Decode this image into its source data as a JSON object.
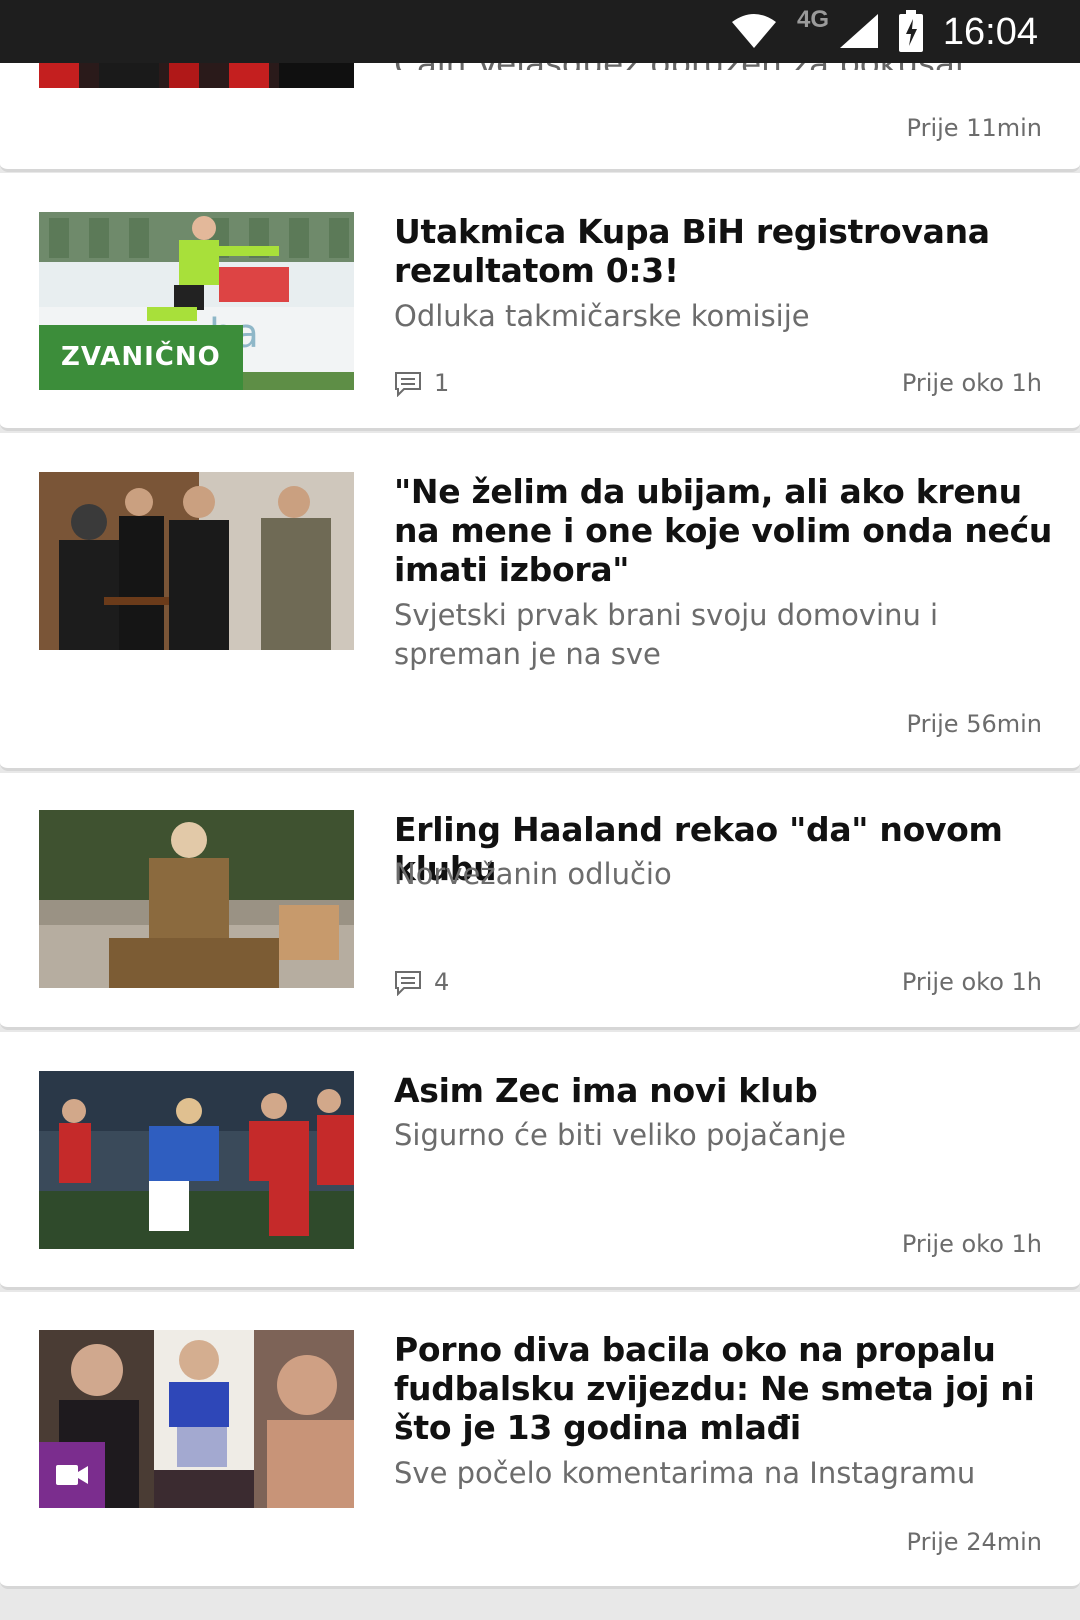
{
  "status_bar": {
    "time": "16:04",
    "network": "4G"
  },
  "articles": [
    {
      "title": "Čain Velasquez optužen za pokušaj ubistva",
      "subtitle": "",
      "time": "Prije 11min",
      "comments": ""
    },
    {
      "title": "Utakmica Kupa BiH registrovana rezultatom 0:3!",
      "subtitle": "Odluka takmičarske komisije",
      "time": "Prije oko 1h",
      "comments": "1",
      "badge": "ZVANIČNO"
    },
    {
      "title": "\"Ne želim da ubijam, ali ako krenu na mene i one koje volim onda neću imati izbora\"",
      "subtitle": "Svjetski prvak brani svoju domovinu i spreman je na sve",
      "time": "Prije 56min",
      "comments": ""
    },
    {
      "title": "Erling Haaland rekao \"da\" novom klubu",
      "subtitle": "Norvežanin odlučio",
      "time": "Prije oko 1h",
      "comments": "4"
    },
    {
      "title": "Asim Zec ima novi klub",
      "subtitle": "Sigurno će biti veliko pojačanje",
      "time": "Prije oko 1h",
      "comments": ""
    },
    {
      "title": "Porno diva bacila oko na propalu fudbalsku zvijezdu: Ne smeta joj ni što je 13 godina mlađi",
      "subtitle": "Sve počelo komentarima na Instagramu",
      "time": "Prije 24min",
      "comments": ""
    }
  ],
  "colors": {
    "badge_green": "#3c8d3a",
    "video_purple": "#7b2d8e"
  },
  "icons": {
    "comment": "comment-icon",
    "video": "video-camera-icon",
    "wifi": "wifi-icon",
    "signal": "signal-icon",
    "battery": "battery-charging-icon"
  }
}
